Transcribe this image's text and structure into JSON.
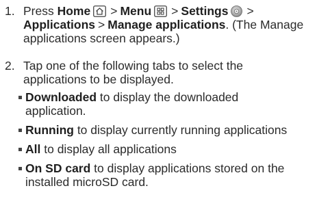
{
  "step1": {
    "number": "1.",
    "press": "Press",
    "home": "Home",
    "menu": "Menu",
    "settings": "Settings",
    "applications": "Applications",
    "manage": "Manage applications",
    "tail1": ". (The Manage",
    "tail2": "applications screen appears.)",
    "separator": ">"
  },
  "step2": {
    "number": "2.",
    "line1": "Tap one of the following tabs to select the",
    "line2": "applications to be displayed."
  },
  "bullets": [
    {
      "term": "Downloaded",
      "rest_line1": " to display the downloaded",
      "rest_line2": "application."
    },
    {
      "term": "Running",
      "rest_line1": " to display currently running applications"
    },
    {
      "term": "All",
      "rest_line1": " to display all applications"
    },
    {
      "term": "On SD card",
      "rest_line1": " to display applications stored on the",
      "rest_line2": "installed microSD card."
    }
  ],
  "icons": {
    "home": "home-key-icon",
    "menu": "menu-key-icon",
    "settings": "settings-gear-icon"
  }
}
